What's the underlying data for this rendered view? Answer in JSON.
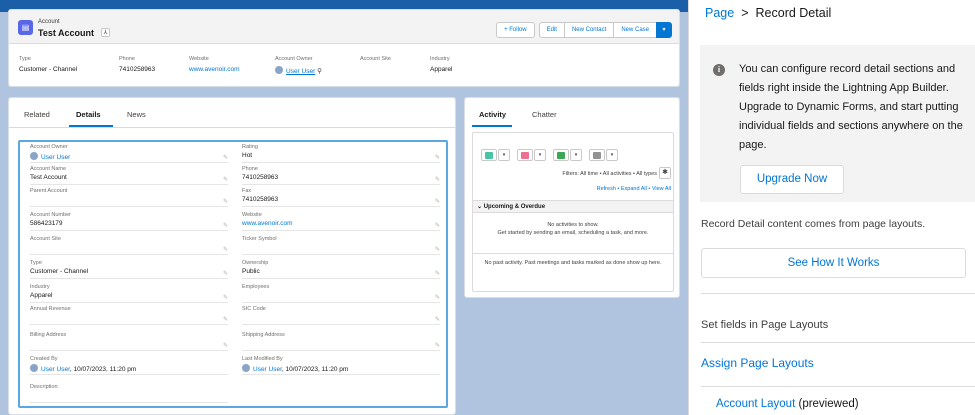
{
  "highlights": {
    "object_type": "Account",
    "account_name": "Test Account",
    "buttons": {
      "follow": "+ Follow",
      "edit": "Edit",
      "new_contact": "New Contact",
      "new_case": "New Case",
      "more": "▾"
    },
    "fields": [
      {
        "label": "Type",
        "value": "Customer - Channel"
      },
      {
        "label": "Phone",
        "value": "7410258963"
      },
      {
        "label": "Website",
        "value": "www.avenoir.com"
      },
      {
        "label": "Account Owner",
        "value": "User User"
      },
      {
        "label": "Account Site",
        "value": ""
      },
      {
        "label": "Industry",
        "value": "Apparel"
      }
    ]
  },
  "details": {
    "tabs": [
      "Related",
      "Details",
      "News"
    ],
    "active_tab": "Details",
    "left_fields": [
      {
        "label": "Account Owner",
        "value": "User User"
      },
      {
        "label": "Account Name",
        "value": "Test Account"
      },
      {
        "label": "Parent Account",
        "value": ""
      },
      {
        "label": "Account Number",
        "value": "586423179"
      },
      {
        "label": "Account Site",
        "value": ""
      },
      {
        "label": "Type",
        "value": "Customer - Channel"
      },
      {
        "label": "Industry",
        "value": "Apparel"
      },
      {
        "label": "Annual Revenue",
        "value": ""
      },
      {
        "label": "Billing Address",
        "value": ""
      },
      {
        "label": "Created By",
        "value": "User User, 10/07/2023, 11:20 pm",
        "user": "User User",
        "stamp": ", 10/07/2023, 11:20 pm"
      },
      {
        "label": "Description",
        "value": ""
      }
    ],
    "right_fields": [
      {
        "label": "Rating",
        "value": "Hot"
      },
      {
        "label": "Phone",
        "value": "7410258963"
      },
      {
        "label": "Fax",
        "value": "7410258963"
      },
      {
        "label": "Website",
        "value": "www.avenoir.com"
      },
      {
        "label": "Ticker Symbol",
        "value": ""
      },
      {
        "label": "Ownership",
        "value": "Public"
      },
      {
        "label": "Employees",
        "value": ""
      },
      {
        "label": "SIC Code",
        "value": ""
      },
      {
        "label": "Shipping Address",
        "value": ""
      },
      {
        "label": "Last Modified By",
        "value": "User User, 10/07/2023, 11:20 pm",
        "user": "User User",
        "stamp": ", 10/07/2023, 11:20 pm"
      }
    ]
  },
  "activity": {
    "tabs": [
      "Activity",
      "Chatter"
    ],
    "active_tab": "Activity",
    "filters_text": "Filters: All time • All activities • All types",
    "links_text": "Refresh • Expand All • View All",
    "upcoming_label": "Upcoming & Overdue",
    "no_activities": "No activities to show.",
    "get_started": "Get started by sending an email, scheduling a task, and more.",
    "past_activity": "No past activity. Past meetings and tasks marked as done show up here."
  },
  "panel": {
    "breadcrumb_page": "Page",
    "breadcrumb_sep": ">",
    "breadcrumb_current": "Record Detail",
    "info_text": "You can configure record detail sections and fields right inside the Lightning App Builder. Upgrade to Dynamic Forms, and start putting individual fields and sections anywhere on the page.",
    "upgrade_button": "Upgrade Now",
    "content_note": "Record Detail content comes from page layouts.",
    "see_button": "See How It Works",
    "set_fields": "Set fields in Page Layouts",
    "assign_link": "Assign Page Layouts",
    "layout_link": "Account Layout",
    "layout_suffix": "(previewed)"
  },
  "colors": {
    "brand_blue": "#0176d3",
    "account_icon": "#5867e8",
    "canvas_bg": "#b0c4df",
    "selection": "#5ba7e1"
  }
}
